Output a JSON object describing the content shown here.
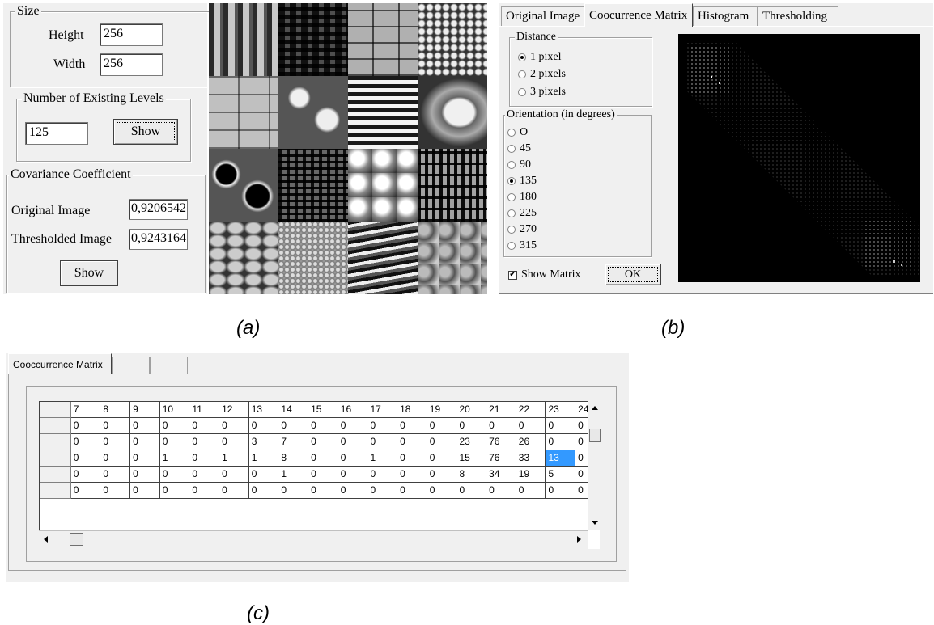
{
  "panel_a": {
    "size_group": {
      "title": "Size",
      "height_label": "Height",
      "height_value": "256",
      "width_label": "Width",
      "width_value": "256"
    },
    "levels_group": {
      "title": "Number of Existing Levels",
      "value": "125",
      "show_button": "Show"
    },
    "covariance_group": {
      "title": "Covariance Coefficient",
      "original_label": "Original Image",
      "original_value": "0,9206542",
      "thresholded_label": "Thresholded Image",
      "thresholded_value": "0,9243164",
      "show_button": "Show"
    },
    "caption": "(a)"
  },
  "panel_b": {
    "tabs": [
      {
        "label": "Original Image"
      },
      {
        "label": "Coocurrence Matrix"
      },
      {
        "label": "Histogram"
      },
      {
        "label": "Thresholding"
      }
    ],
    "distance_group": {
      "title": "Distance",
      "options": [
        {
          "label": "1 pixel",
          "selected": true
        },
        {
          "label": "2 pixels",
          "selected": false
        },
        {
          "label": "3 pixels",
          "selected": false
        }
      ]
    },
    "orientation_group": {
      "title": "Orientation (in degrees)",
      "options": [
        {
          "label": "O",
          "selected": false
        },
        {
          "label": "45",
          "selected": false
        },
        {
          "label": "90",
          "selected": false
        },
        {
          "label": "135",
          "selected": true
        },
        {
          "label": "180",
          "selected": false
        },
        {
          "label": "225",
          "selected": false
        },
        {
          "label": "270",
          "selected": false
        },
        {
          "label": "315",
          "selected": false
        }
      ]
    },
    "show_matrix_label": "Show Matrix",
    "show_matrix_checked": true,
    "ok_button": "OK",
    "caption": "(b)"
  },
  "panel_c": {
    "tabs": [
      {
        "label": "Cooccurrence Matrix"
      },
      {
        "label": ""
      },
      {
        "label": ""
      }
    ],
    "column_headers": [
      "7",
      "8",
      "9",
      "10",
      "11",
      "12",
      "13",
      "14",
      "15",
      "16",
      "17",
      "18",
      "19",
      "20",
      "21",
      "22",
      "23",
      "24"
    ],
    "rows": [
      [
        "0",
        "0",
        "0",
        "0",
        "0",
        "0",
        "0",
        "0",
        "0",
        "0",
        "0",
        "0",
        "0",
        "0",
        "0",
        "0",
        "0",
        "0"
      ],
      [
        "0",
        "0",
        "0",
        "0",
        "0",
        "0",
        "3",
        "7",
        "0",
        "0",
        "0",
        "0",
        "0",
        "23",
        "76",
        "26",
        "0",
        "0"
      ],
      [
        "0",
        "0",
        "0",
        "1",
        "0",
        "1",
        "1",
        "8",
        "0",
        "0",
        "1",
        "0",
        "0",
        "15",
        "76",
        "33",
        "13",
        "0"
      ],
      [
        "0",
        "0",
        "0",
        "0",
        "0",
        "0",
        "0",
        "1",
        "0",
        "0",
        "0",
        "0",
        "0",
        "8",
        "34",
        "19",
        "5",
        "0"
      ],
      [
        "0",
        "0",
        "0",
        "0",
        "0",
        "0",
        "0",
        "0",
        "0",
        "0",
        "0",
        "0",
        "0",
        "0",
        "0",
        "0",
        "0",
        "0"
      ]
    ],
    "selected_cell": {
      "row": 2,
      "col": 16
    },
    "caption": "(c)"
  },
  "colors": {
    "window_bg": "#f0f0f0",
    "selection": "#3399ff",
    "matrix_bg": "#000000"
  }
}
